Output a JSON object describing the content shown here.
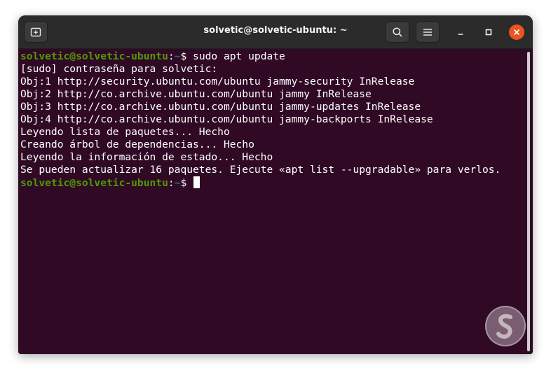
{
  "window": {
    "title": "solvetic@solvetic-ubuntu: ~"
  },
  "icons": {
    "new_tab": "new-tab-icon",
    "search": "search-icon",
    "menu": "hamburger-menu-icon",
    "minimize": "minimize-icon",
    "maximize": "maximize-icon",
    "close": "close-icon",
    "watermark": "solvetic-logo"
  },
  "colors": {
    "terminal_bg": "#300a24",
    "titlebar_bg": "#2b2b2b",
    "prompt_user": "#4e9a06",
    "prompt_path": "#3465a4",
    "close_button": "#e95420"
  },
  "terminal": {
    "prompt": {
      "user": "solvetic@solvetic-ubuntu",
      "sep": ":",
      "path": "~",
      "sym": "$ "
    },
    "command": "sudo apt update",
    "output": [
      "[sudo] contraseña para solvetic:",
      "Obj:1 http://security.ubuntu.com/ubuntu jammy-security InRelease",
      "Obj:2 http://co.archive.ubuntu.com/ubuntu jammy InRelease",
      "Obj:3 http://co.archive.ubuntu.com/ubuntu jammy-updates InRelease",
      "Obj:4 http://co.archive.ubuntu.com/ubuntu jammy-backports InRelease",
      "Leyendo lista de paquetes... Hecho",
      "Creando árbol de dependencias... Hecho",
      "Leyendo la información de estado... Hecho",
      "Se pueden actualizar 16 paquetes. Ejecute «apt list --upgradable» para verlos."
    ]
  }
}
